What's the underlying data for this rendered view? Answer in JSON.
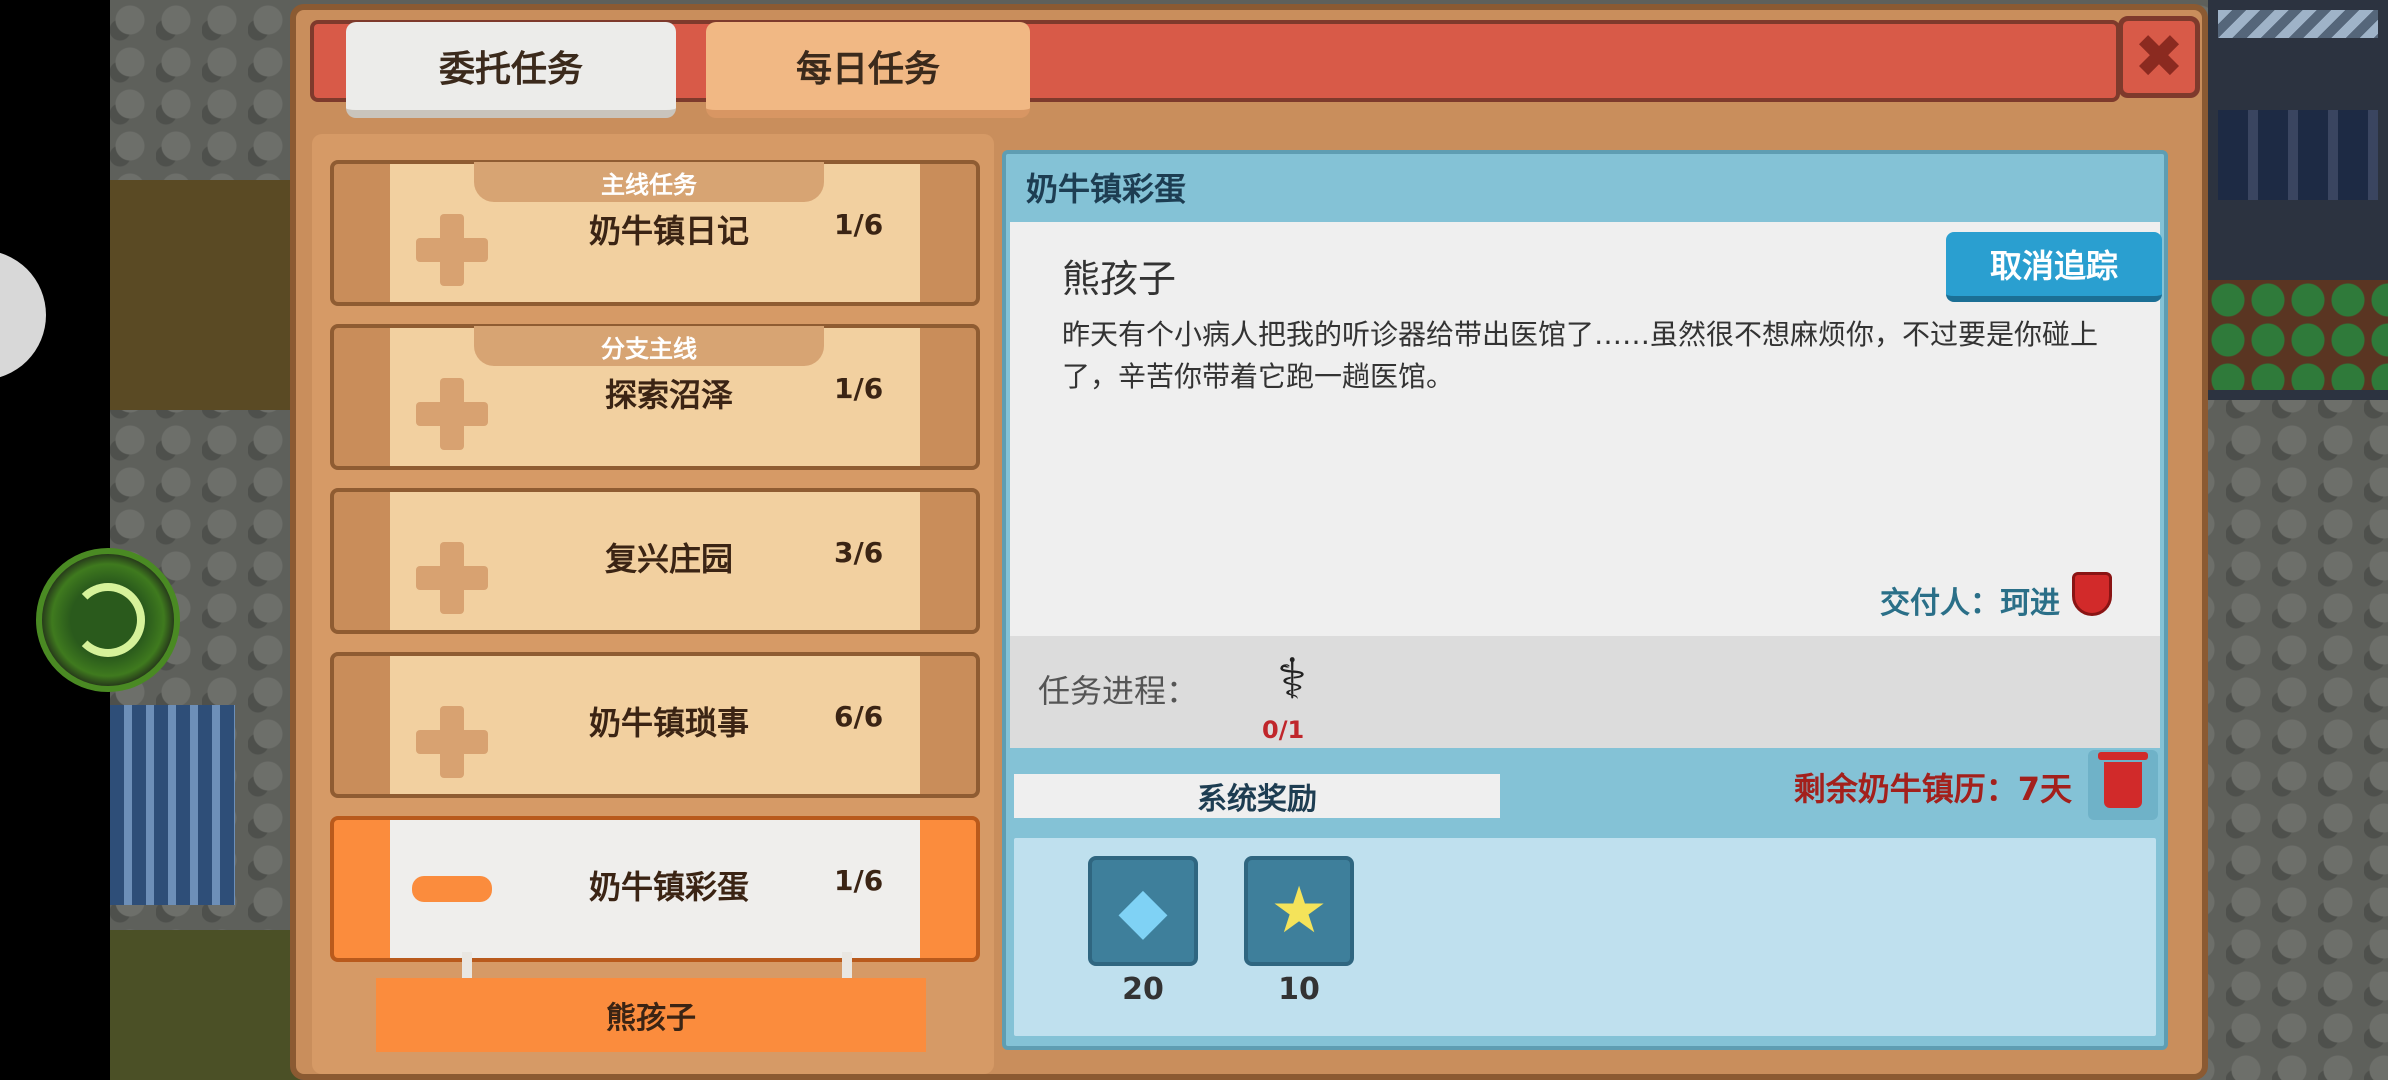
{
  "tabs": {
    "commission": "委托任务",
    "daily": "每日任务"
  },
  "close_icon": "✖",
  "quests": [
    {
      "tag": "主线任务",
      "name": "奶牛镇日记",
      "count": "1/6"
    },
    {
      "tag": "分支主线",
      "name": "探索沼泽",
      "count": "1/6"
    },
    {
      "tag": "",
      "name": "复兴庄园",
      "count": "3/6"
    },
    {
      "tag": "",
      "name": "奶牛镇琐事",
      "count": "6/6"
    },
    {
      "tag": "",
      "name": "奶牛镇彩蛋",
      "count": "1/6",
      "active": true
    }
  ],
  "sub_quest": "熊孩子",
  "detail": {
    "category": "奶牛镇彩蛋",
    "title": "熊孩子",
    "untrack": "取消追踪",
    "description": "昨天有个小病人把我的听诊器给带出医馆了……虽然很不想麻烦你，不过要是你碰上了，辛苦你带着它跑一趟医馆。",
    "giver": "交付人：珂进",
    "progress_label": "任务进程：",
    "progress_icon": "stethoscope-icon",
    "progress_count": "0/1",
    "reward_tab": "系统奖励",
    "remaining": "剩余奶牛镇历：7天",
    "rewards": [
      {
        "icon": "gem-icon",
        "qty": "20"
      },
      {
        "icon": "star-icon",
        "qty": "10"
      }
    ]
  }
}
